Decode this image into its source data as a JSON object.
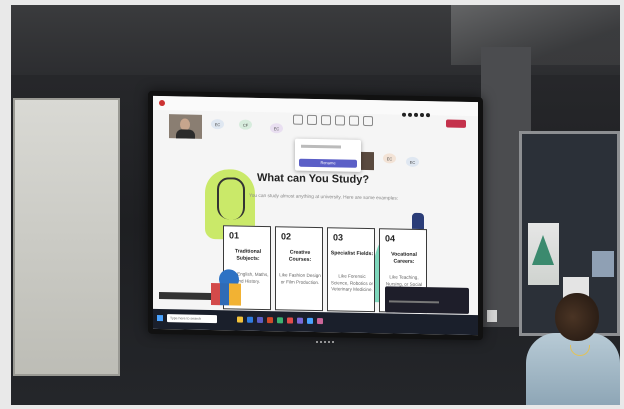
{
  "scene": {
    "screen": {
      "meeting_title": "",
      "controls": [
        "chat",
        "people",
        "raise",
        "react",
        "view",
        "more"
      ],
      "tiles": [
        "EC",
        "CF",
        "EC",
        "EC",
        "EC"
      ],
      "popup": {
        "button_label": "Rename"
      },
      "slide": {
        "title": "What can You Study?",
        "subtitle": "You can study almost anything at university. Here are some examples:",
        "cards": [
          {
            "num": "01",
            "title": "Traditional Subjects:",
            "desc": "Like English, Maths, and History."
          },
          {
            "num": "02",
            "title": "Creative Courses:",
            "desc": "Like Fashion Design or Film Production."
          },
          {
            "num": "03",
            "title": "Specialist Fields:",
            "desc": "Like Forensic Science, Robotics or Veterinary Medicine."
          },
          {
            "num": "04",
            "title": "Vocational Careers:",
            "desc": "Like Teaching, Nursing, or Social Work."
          }
        ]
      },
      "taskbar": {
        "search_placeholder": "Type here to search"
      },
      "accent_colors": {
        "teams_purple": "#5b5fc7",
        "leave_red": "#c4314b",
        "bulb_green": "#c5e85a",
        "teal": "#69d1b1"
      }
    }
  }
}
